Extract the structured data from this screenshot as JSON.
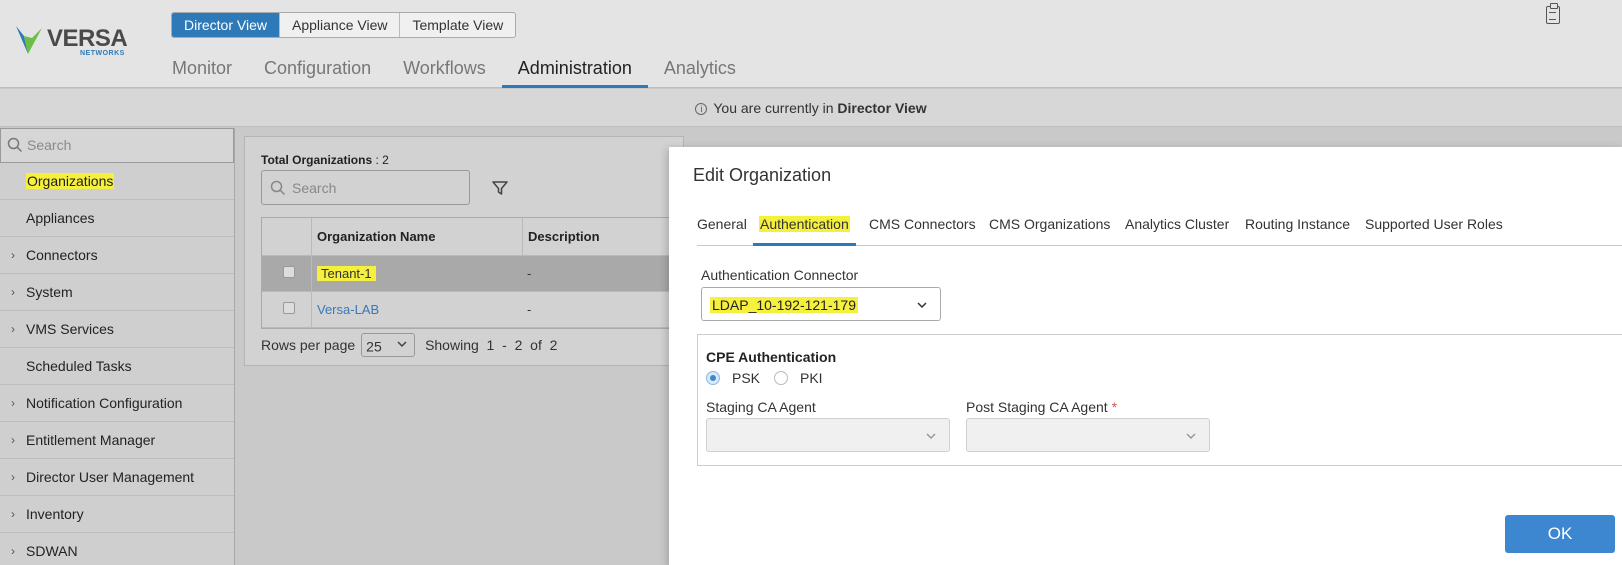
{
  "app": {
    "brand": "VERSA",
    "brand_sub": "NETWORKS"
  },
  "view_tabs": [
    {
      "label": "Director View",
      "active": true
    },
    {
      "label": "Appliance View",
      "active": false
    },
    {
      "label": "Template View",
      "active": false
    }
  ],
  "main_nav": [
    {
      "label": "Monitor"
    },
    {
      "label": "Configuration"
    },
    {
      "label": "Workflows"
    },
    {
      "label": "Administration",
      "active": true
    },
    {
      "label": "Analytics"
    }
  ],
  "info_bar": {
    "prefix": "You are currently in",
    "view": "Director View"
  },
  "sidebar": {
    "search_placeholder": "Search",
    "items": [
      {
        "label": "Organizations",
        "expandable": false,
        "highlighted": true
      },
      {
        "label": "Appliances",
        "expandable": false
      },
      {
        "label": "Connectors",
        "expandable": true
      },
      {
        "label": "System",
        "expandable": true
      },
      {
        "label": "VMS Services",
        "expandable": true
      },
      {
        "label": "Scheduled Tasks",
        "expandable": false
      },
      {
        "label": "Notification Configuration",
        "expandable": true
      },
      {
        "label": "Entitlement Manager",
        "expandable": true
      },
      {
        "label": "Director User Management",
        "expandable": true
      },
      {
        "label": "Inventory",
        "expandable": true
      },
      {
        "label": "SDWAN",
        "expandable": true
      }
    ]
  },
  "org_panel": {
    "total_label": "Total Organizations",
    "total_sep": " : ",
    "total_value": "2",
    "search_placeholder": "Search",
    "columns": [
      "Organization Name",
      "Description"
    ],
    "rows": [
      {
        "name": "Tenant-1",
        "description": "-",
        "selected": true,
        "highlighted": true
      },
      {
        "name": "Versa-LAB",
        "description": "-",
        "selected": false
      }
    ],
    "rows_per_page_label": "Rows per page",
    "rows_per_page": "25",
    "showing_label": "Showing",
    "showing_from": "1",
    "showing_dash": "-",
    "showing_to": "2",
    "showing_of": "of",
    "showing_total": "2"
  },
  "modal": {
    "title": "Edit Organization",
    "tabs": [
      {
        "label": "General"
      },
      {
        "label": "Authentication",
        "active": true
      },
      {
        "label": "CMS Connectors"
      },
      {
        "label": "CMS Organizations"
      },
      {
        "label": "Analytics Cluster"
      },
      {
        "label": "Routing Instance"
      },
      {
        "label": "Supported User Roles"
      }
    ],
    "auth_connector_label": "Authentication Connector",
    "auth_connector_value": "LDAP_10-192-121-179",
    "cpe_title": "CPE Authentication",
    "radio_psk": "PSK",
    "radio_pki": "PKI",
    "radio_selected": "PSK",
    "staging_label": "Staging CA Agent",
    "post_staging_label": "Post Staging CA Agent",
    "required_mark": "*",
    "ok_label": "OK"
  },
  "colors": {
    "accent": "#2e7ab8",
    "highlight": "#f5ef3e",
    "link": "#3a78b8",
    "ok_button": "#3d86d0"
  }
}
